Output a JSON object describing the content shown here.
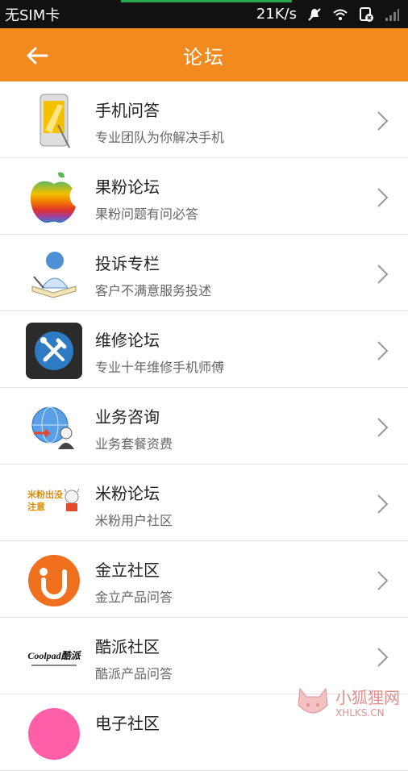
{
  "status": {
    "carrier": "无SIM卡",
    "speed": "21K/s"
  },
  "header": {
    "title": "论坛",
    "accent_color": "#f28a1f"
  },
  "items": [
    {
      "title": "手机问答",
      "subtitle": "专业团队为你解决手机",
      "icon": "phone-icon"
    },
    {
      "title": "果粉论坛",
      "subtitle": "果粉问题有问必答",
      "icon": "apple-logo-icon"
    },
    {
      "title": "投诉专栏",
      "subtitle": "客户不满意服务投述",
      "icon": "person-book-icon"
    },
    {
      "title": "维修论坛",
      "subtitle": "专业十年维修手机师傅",
      "icon": "repair-tools-icon"
    },
    {
      "title": "业务咨询",
      "subtitle": "业务套餐资费",
      "icon": "globe-user-icon"
    },
    {
      "title": "米粉论坛",
      "subtitle": "米粉用户社区",
      "icon": "mi-fan-icon",
      "icon_text": "米粉出没\n注意"
    },
    {
      "title": "金立社区",
      "subtitle": "金立产品问答",
      "icon": "gionee-logo-icon"
    },
    {
      "title": "酷派社区",
      "subtitle": "酷派产品问答",
      "icon": "coolpad-logo-icon",
      "icon_text": "Coolpad酷派"
    },
    {
      "title": "电子社区",
      "subtitle": "",
      "icon": "pink-circle-icon"
    }
  ],
  "watermark": {
    "cn": "小狐狸网",
    "en": "XHLKS.CN"
  }
}
